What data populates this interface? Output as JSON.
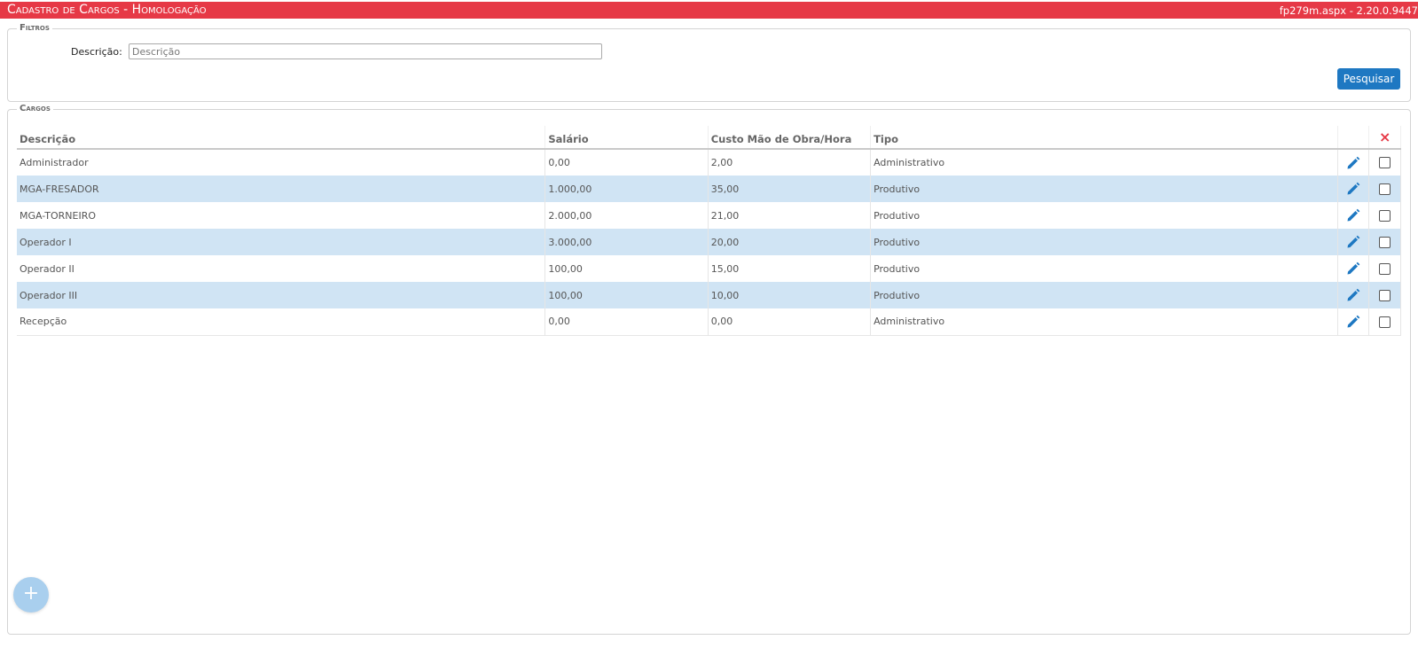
{
  "header": {
    "title": "Cadastro de Cargos  - Homologação",
    "version": "fp279m.aspx - 2.20.0.9447"
  },
  "filters": {
    "legend": "Filtros",
    "description_label": "Descrição:",
    "description_placeholder": "Descrição",
    "description_value": "",
    "search_button": "Pesquisar"
  },
  "cargos": {
    "legend": "Cargos",
    "columns": [
      "Descrição",
      "Salário",
      "Custo Mão de Obra/Hora",
      "Tipo"
    ],
    "delete_header_icon": "×",
    "rows": [
      {
        "descricao": "Administrador",
        "salario": "0,00",
        "custo": "2,00",
        "tipo": "Administrativo"
      },
      {
        "descricao": "MGA-FRESADOR",
        "salario": "1.000,00",
        "custo": "35,00",
        "tipo": "Produtivo"
      },
      {
        "descricao": "MGA-TORNEIRO",
        "salario": "2.000,00",
        "custo": "21,00",
        "tipo": "Produtivo"
      },
      {
        "descricao": "Operador I",
        "salario": "3.000,00",
        "custo": "20,00",
        "tipo": "Produtivo"
      },
      {
        "descricao": "Operador II",
        "salario": "100,00",
        "custo": "15,00",
        "tipo": "Produtivo"
      },
      {
        "descricao": "Operador III",
        "salario": "100,00",
        "custo": "10,00",
        "tipo": "Produtivo"
      },
      {
        "descricao": "Recepção",
        "salario": "0,00",
        "custo": "0,00",
        "tipo": "Administrativo"
      }
    ]
  },
  "add_button": "+",
  "colors": {
    "header_bar": "#e63946",
    "primary_button": "#1e78c2",
    "row_alt": "#d0e4f4",
    "edit_icon": "#1e78c2",
    "delete_icon": "#e63946",
    "fab": "#a9cfee"
  },
  "icons": {
    "edit": "pencil-icon",
    "delete_header": "close-icon",
    "add": "plus-icon"
  }
}
